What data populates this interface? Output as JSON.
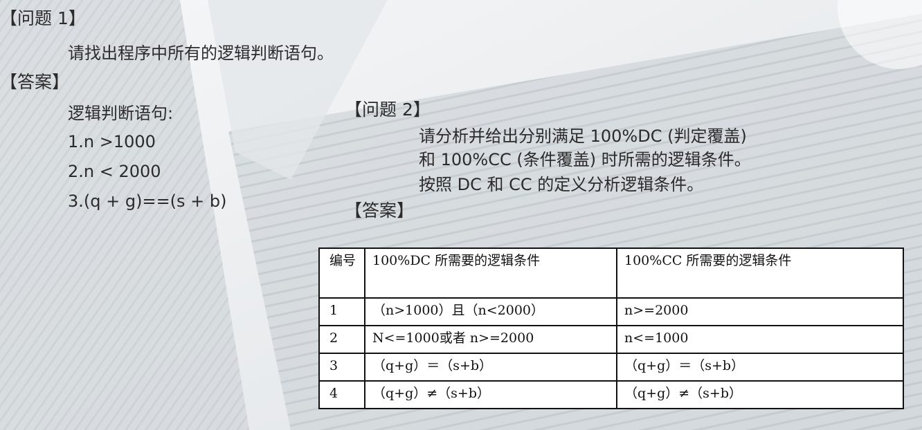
{
  "q1": {
    "title": "【问题 1】",
    "question": "请找出程序中所有的逻辑判断语句。",
    "answer_title": "【答案】",
    "answer_heading": "逻辑判断语句:",
    "answers": [
      "1.n >1000",
      "2.n < 2000",
      "3.(q + g)==(s + b)"
    ]
  },
  "q2": {
    "title": "【问题 2】",
    "question_lines": [
      "请分析并给出分别满足 100%DC (判定覆盖)",
      "和 100%CC (条件覆盖) 时所需的逻辑条件。",
      "按照 DC 和 CC 的定义分析逻辑条件。"
    ],
    "answer_title": "【答案】"
  },
  "table": {
    "headers": [
      "编号",
      "100%DC 所需要的逻辑条件",
      "100%CC 所需要的逻辑条件"
    ],
    "rows": [
      [
        "1",
        "（n>1000）且（n<2000）",
        "n>=2000"
      ],
      [
        "2",
        "N<=1000或者 n>=2000",
        "n<=1000"
      ],
      [
        "3",
        "（q+g）＝（s+b）",
        "（q+g）＝（s+b）"
      ],
      [
        "4",
        "（q+g）≠（s+b）",
        "（q+g）≠（s+b）"
      ]
    ]
  },
  "colors": {
    "background": "#eceeef",
    "building": "#c9ced3",
    "text": "#2b2b2b"
  }
}
